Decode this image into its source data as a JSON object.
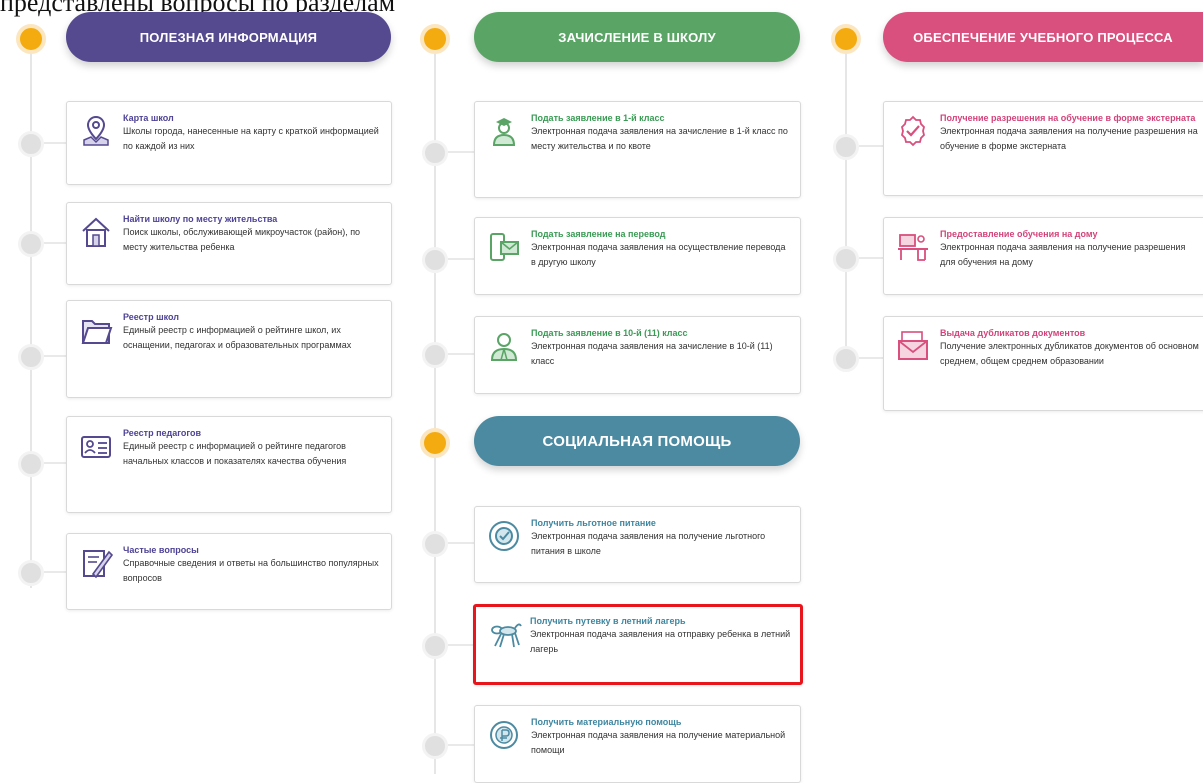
{
  "top_text": "представлены вопросы по разделам",
  "colors": {
    "purple": "#55498f",
    "green": "#5aa566",
    "pink": "#d94f7d",
    "teal": "#4c8aa1",
    "orange_dot": "#f4ab10",
    "highlight": "#e8161c"
  },
  "columns": [
    {
      "header": "ПОЛЕЗНАЯ ИНФОРМАЦИЯ",
      "items": [
        {
          "title": "Карта школ",
          "desc": "Школы города, нанесенные на карту с краткой информацией по каждой из них",
          "icon": "map-pin-icon"
        },
        {
          "title": "Найти школу по месту жительства",
          "desc": "Поиск школы, обслуживающей микроучасток (район), по месту жительства ребенка",
          "icon": "house-icon"
        },
        {
          "title": "Реестр школ",
          "desc": "Единый реестр с информацией о рейтинге школ, их оснащении, педагогах и образовательных программах",
          "icon": "folder-icon"
        },
        {
          "title": "Реестр педагогов",
          "desc": "Единый реестр с информацией о рейтинге педагогов начальных классов и показателях качества обучения",
          "icon": "id-card-icon"
        },
        {
          "title": "Частые вопросы",
          "desc": "Справочные сведения и ответы на большинство популярных вопросов",
          "icon": "notepad-pencil-icon"
        }
      ]
    },
    {
      "header": "ЗАЧИСЛЕНИЕ В ШКОЛУ",
      "items": [
        {
          "title": "Подать заявление в 1-й класс",
          "desc": "Электронная подача заявления на зачисление в 1-й класс по месту жительства и по квоте",
          "icon": "student-icon"
        },
        {
          "title": "Подать заявление на перевод",
          "desc": "Электронная подача заявления на осуществление перевода в другую школу",
          "icon": "phone-envelope-icon"
        },
        {
          "title": "Подать заявление в 10-й (11) класс",
          "desc": "Электронная подача заявления на зачисление в 10-й (11) класс",
          "icon": "graduate-icon"
        }
      ]
    },
    {
      "header": "СОЦИАЛЬНАЯ ПОМОЩЬ",
      "items": [
        {
          "title": "Получить льготное питание",
          "desc": "Электронная подача заявления на получение льготного питания в школе",
          "icon": "plate-icon"
        },
        {
          "title": "Получить путевку в летний лагерь",
          "desc": "Электронная подача заявления на отправку ребенка в летний лагерь",
          "icon": "balloon-dog-icon",
          "highlighted": true
        },
        {
          "title": "Получить материальную помощь",
          "desc": "Электронная подача заявления на получение материальной помощи",
          "icon": "coin-icon"
        }
      ]
    },
    {
      "header": "ОБЕСПЕЧЕНИЕ УЧЕБНОГО ПРОЦЕССА",
      "items": [
        {
          "title": "Получение разрешения на обучение в форме экстерната",
          "desc": "Электронная подача заявления на получение разрешения на обучение в форме экстерната",
          "icon": "approval-badge-icon"
        },
        {
          "title": "Предоставление обучения на дому",
          "desc": "Электронная подача заявления на получение разрешения для обучения на дому",
          "icon": "home-desk-icon"
        },
        {
          "title": "Выдача дубликатов документов",
          "desc": "Получение электронных дубликатов документов об основном среднем, общем среднем образовании",
          "icon": "envelope-icon"
        }
      ]
    }
  ]
}
